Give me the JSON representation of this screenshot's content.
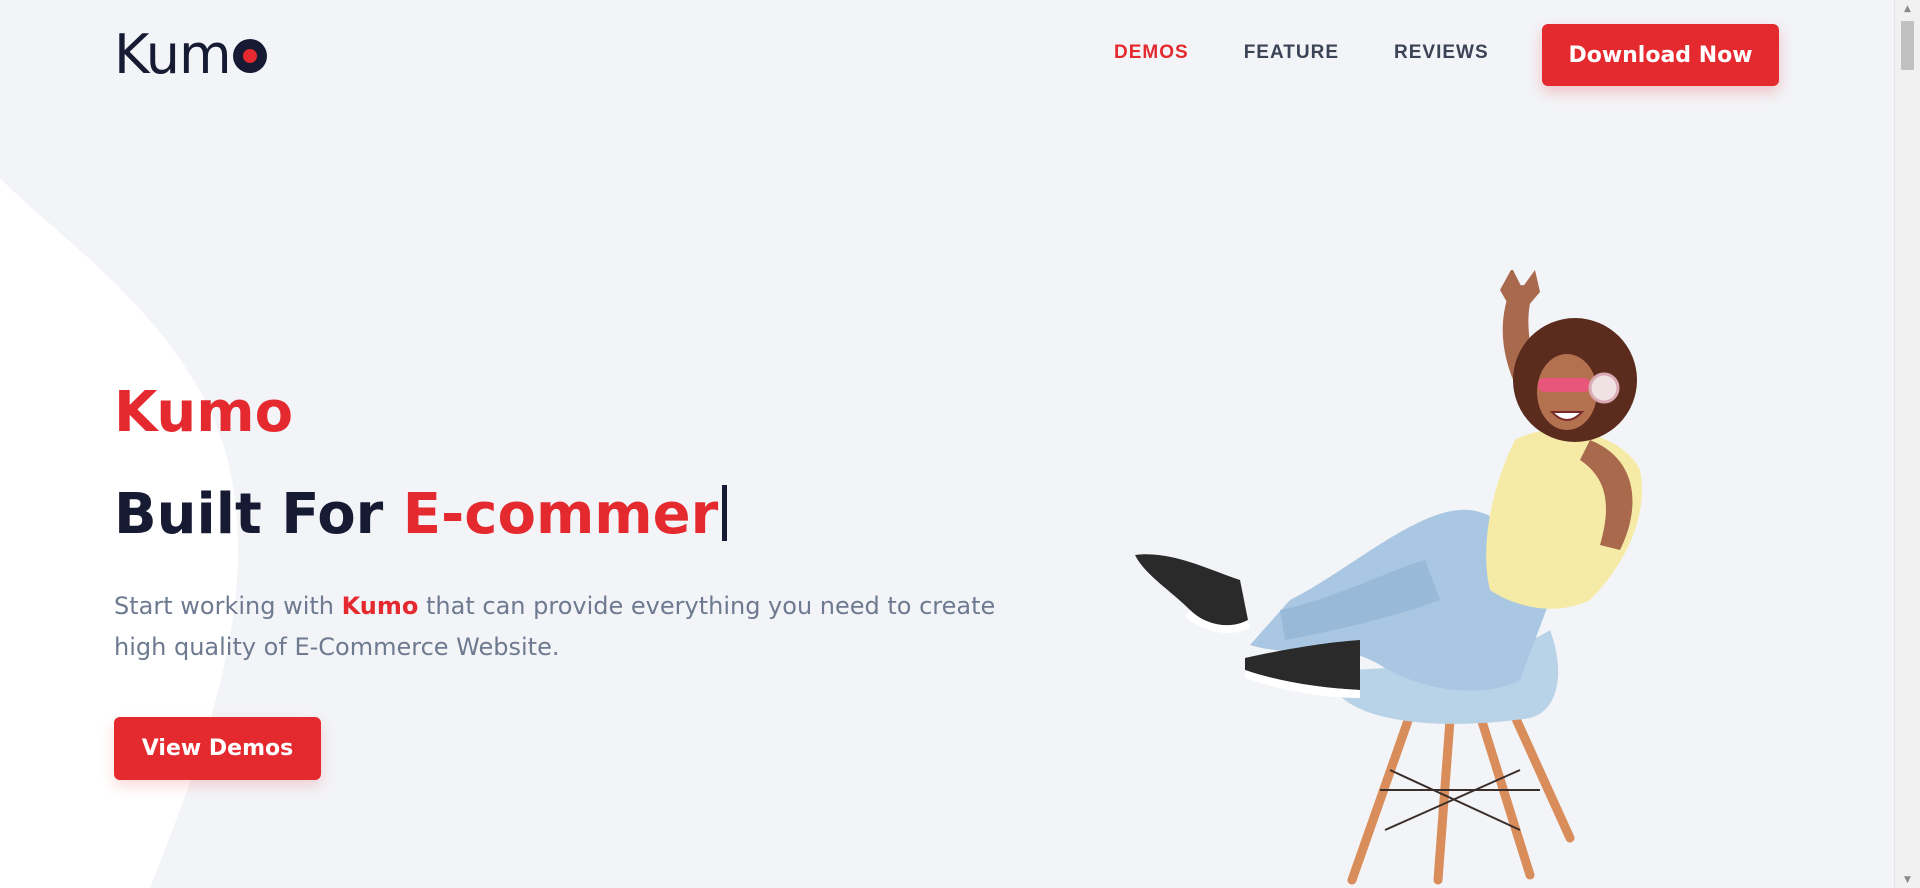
{
  "header": {
    "logo_text": "Kum",
    "logo_tail": "o",
    "nav": [
      {
        "label": "DEMOS",
        "active": true
      },
      {
        "label": "FEATURE",
        "active": false
      },
      {
        "label": "REVIEWS",
        "active": false
      }
    ],
    "download_label": "Download Now"
  },
  "hero": {
    "brand": "Kumo",
    "title_prefix": "Built For ",
    "title_accent": "E-commer",
    "description_before": "Start working with ",
    "description_brand": "Kumo",
    "description_after": " that can provide everything you need to create high quality of E-Commerce Website.",
    "cta_label": "View Demos"
  },
  "colors": {
    "accent": "#e42a2f",
    "dark": "#161a33",
    "background": "#f3f4f7",
    "muted_text": "#6d7a90"
  },
  "scrollbar": {
    "up_icon": "▲",
    "down_icon": "▼"
  }
}
